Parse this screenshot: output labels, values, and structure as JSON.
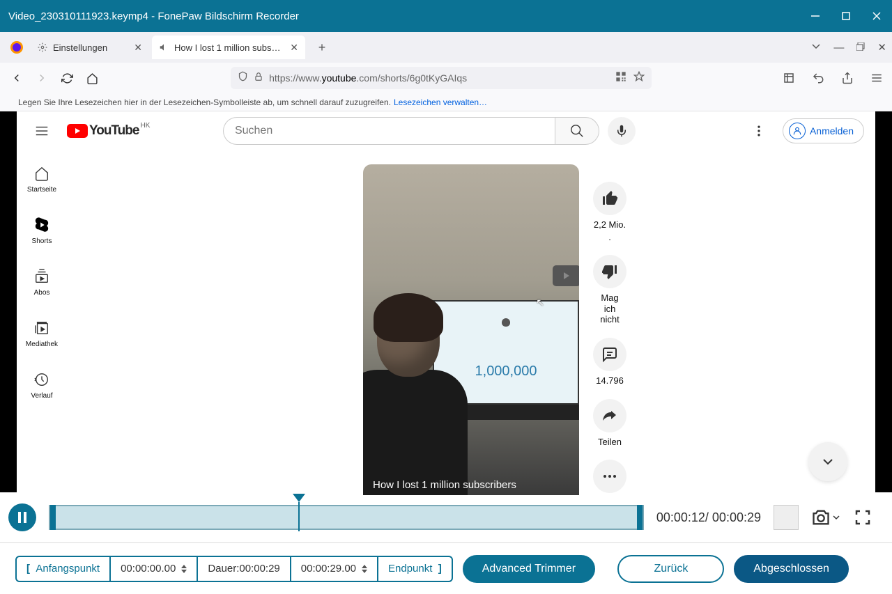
{
  "window": {
    "title": "Video_230310111923.keymp4  -  FonePaw Bildschirm Recorder"
  },
  "browser": {
    "tabs": [
      {
        "label": "Einstellungen",
        "icon": "gear"
      },
      {
        "label": "How I lost 1 million subscribers",
        "icon": "sound",
        "active": true
      }
    ],
    "url_prefix": "https://www.",
    "url_domain": "youtube",
    "url_suffix": ".com/shorts/6g0tKyGAIqs",
    "bookmark_hint": "Legen Sie Ihre Lesezeichen hier in der Lesezeichen-Symbolleiste ab, um schnell darauf zuzugreifen.",
    "bookmark_link": "Lesezeichen verwalten…"
  },
  "youtube": {
    "logo_text": "YouTube",
    "region": "HK",
    "search_placeholder": "Suchen",
    "signin": "Anmelden",
    "sidebar": [
      {
        "label": "Startseite",
        "icon": "home"
      },
      {
        "label": "Shorts",
        "icon": "shorts",
        "active": true
      },
      {
        "label": "Abos",
        "icon": "subscriptions"
      },
      {
        "label": "Mediathek",
        "icon": "library"
      },
      {
        "label": "Verlauf",
        "icon": "history"
      }
    ],
    "short": {
      "title": "How I lost 1 million subscribers",
      "sub_number": "1,000,000"
    },
    "actions": {
      "like": "2,2 Mio.",
      "dislike": "Mag ich nicht",
      "comments": "14.796",
      "share": "Teilen"
    }
  },
  "editor": {
    "current_time": "00:00:12",
    "total_time": "00:00:29",
    "start_label": "Anfangspunkt",
    "start_value": "00:00:00.00",
    "duration_label": "Dauer:",
    "duration_value": "00:00:29",
    "end_value": "00:00:29.00",
    "end_label": "Endpunkt",
    "advanced": "Advanced Trimmer",
    "back": "Zurück",
    "done": "Abgeschlossen"
  }
}
